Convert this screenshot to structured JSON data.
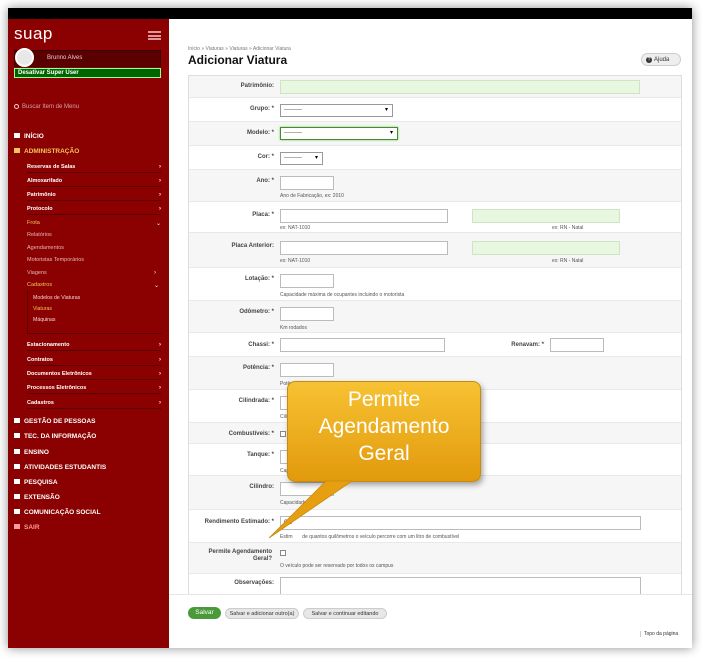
{
  "app": {
    "logo": "suap",
    "user_name": "Brunno Alves",
    "super_user_button": "Desativar Super User",
    "search_placeholder": "Buscar Item de Menu"
  },
  "nav": {
    "top": [
      {
        "label": "INÍCIO",
        "icon": "home-icon"
      },
      {
        "label": "ADMINISTRAÇÃO",
        "icon": "admin-icon"
      }
    ],
    "admin_items": [
      "Reservas de Salas",
      "Almoxarifado",
      "Patrimônio",
      "Protocolo"
    ],
    "frota": "Frota",
    "frota_items": [
      "Relatórios",
      "Agendamentos",
      "Motoristas Temporários",
      "Viagens"
    ],
    "cadastros": "Cadastros",
    "cadastros_items": [
      "Modelos de Viaturas",
      "Viaturas",
      "Máquinas"
    ],
    "admin_items2": [
      "Estacionamento",
      "Contratos",
      "Documentos Eletrônicos",
      "Processos Eletrônicos",
      "Cadastros"
    ],
    "bottom": [
      {
        "label": "GESTÃO DE PESSOAS",
        "icon": "people-icon"
      },
      {
        "label": "TEC. DA INFORMAÇÃO",
        "icon": "monitor-icon"
      },
      {
        "label": "ENSINO",
        "icon": "pencil-icon"
      },
      {
        "label": "ATIVIDADES ESTUDANTIS",
        "icon": "flag-icon"
      },
      {
        "label": "PESQUISA",
        "icon": "globe-icon"
      },
      {
        "label": "EXTENSÃO",
        "icon": "briefcase-icon"
      },
      {
        "label": "COMUNICAÇÃO SOCIAL",
        "icon": "chat-icon"
      },
      {
        "label": "SAIR",
        "icon": "logout-icon"
      }
    ]
  },
  "page": {
    "breadcrumb": "Início » Viaturas » Viaturas » Adicionar Viatura",
    "title": "Adicionar Viatura",
    "help": "Ajuda"
  },
  "form": {
    "patrimonio": "Patrimônio:",
    "grupo": "Grupo:",
    "grupo_value": "---------",
    "modelo": "Modelo:",
    "modelo_value": "---------",
    "cor": "Cor:",
    "cor_value": "---------",
    "ano": "Ano:",
    "ano_help": "Ano de Fabricação, ex: 2010",
    "placa": "Placa:",
    "placa_help": "ex: NAT-1010",
    "placa_help2": "ex: RN - Natal",
    "placa_anterior": "Placa Anterior:",
    "placa_ant_help": "ex: NAT-1010",
    "placa_ant_help2": "ex: RN - Natal",
    "lotacao": "Lotação:",
    "lotacao_help": "Capacidade máxima de ocupantes incluindo o motorista",
    "odometro": "Odômetro:",
    "odometro_help": "Km rodados",
    "chassi": "Chassi:",
    "renavam": "Renavam:",
    "potencia": "Potência:",
    "potencia_help": "Potência em hp",
    "cilindrada": "Cilindrada:",
    "cilindrada_help": "Cilind",
    "combustiveis": "Combustíveis:",
    "combustiveis_opt": "G",
    "tanque": "Tanque:",
    "tanque_help": "Capac",
    "cilindro": "Cilindro:",
    "cilindro_help": "Capacidade (m³)",
    "rendimento": "Rendimento Estimado:",
    "rendimento_value": "0.0",
    "rendimento_help": "Estim       de quantos quilômetros o veículo percorre com um litro de combustível",
    "permite": "Permite Agendamento Geral?",
    "permite_help": "O veículo pode ser reservado por todos os campus",
    "observacoes": "Observações:",
    "req": "*"
  },
  "buttons": {
    "save": "Salvar",
    "save_add": "Salvar e adicionar outro(a)",
    "save_continue": "Salvar e continuar editando",
    "topo": "Topo da página"
  },
  "callout": {
    "line1": "Permite",
    "line2": "Agendamento",
    "line3": "Geral",
    "color": "#f2b324"
  }
}
